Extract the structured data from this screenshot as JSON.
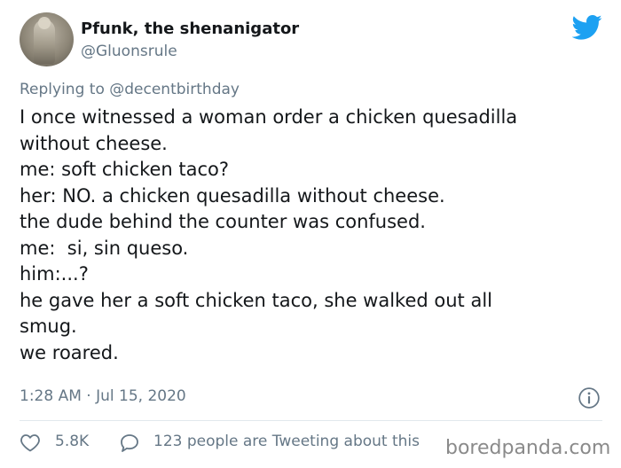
{
  "author": {
    "display_name": "Pfunk, the shenanigator",
    "handle": "@Gluonsrule"
  },
  "reply": {
    "prefix": "Replying to ",
    "mention": "@decentbirthday"
  },
  "tweet": {
    "lines": [
      "I once witnessed a woman order a chicken quesadilla",
      "without cheese.",
      "me: soft chicken taco?",
      "her: NO. a chicken quesadilla without cheese.",
      "the dude behind the counter was confused.",
      "me:  si, sin queso.",
      "him:...?",
      "he gave her a soft chicken taco, she walked out all",
      "smug.",
      "we roared."
    ],
    "timestamp": "1:28 AM · Jul 15, 2020"
  },
  "engagement": {
    "likes": "5.8K",
    "tweeting": "123 people are Tweeting about this"
  },
  "watermark": "boredpanda.com",
  "icons": {
    "brand": "twitter-bird-icon",
    "info": "info-icon",
    "like": "heart-icon",
    "reply": "speech-bubble-icon"
  },
  "colors": {
    "twitter_blue": "#1da1f2",
    "secondary_text": "#657786",
    "primary_text": "#14171a"
  }
}
